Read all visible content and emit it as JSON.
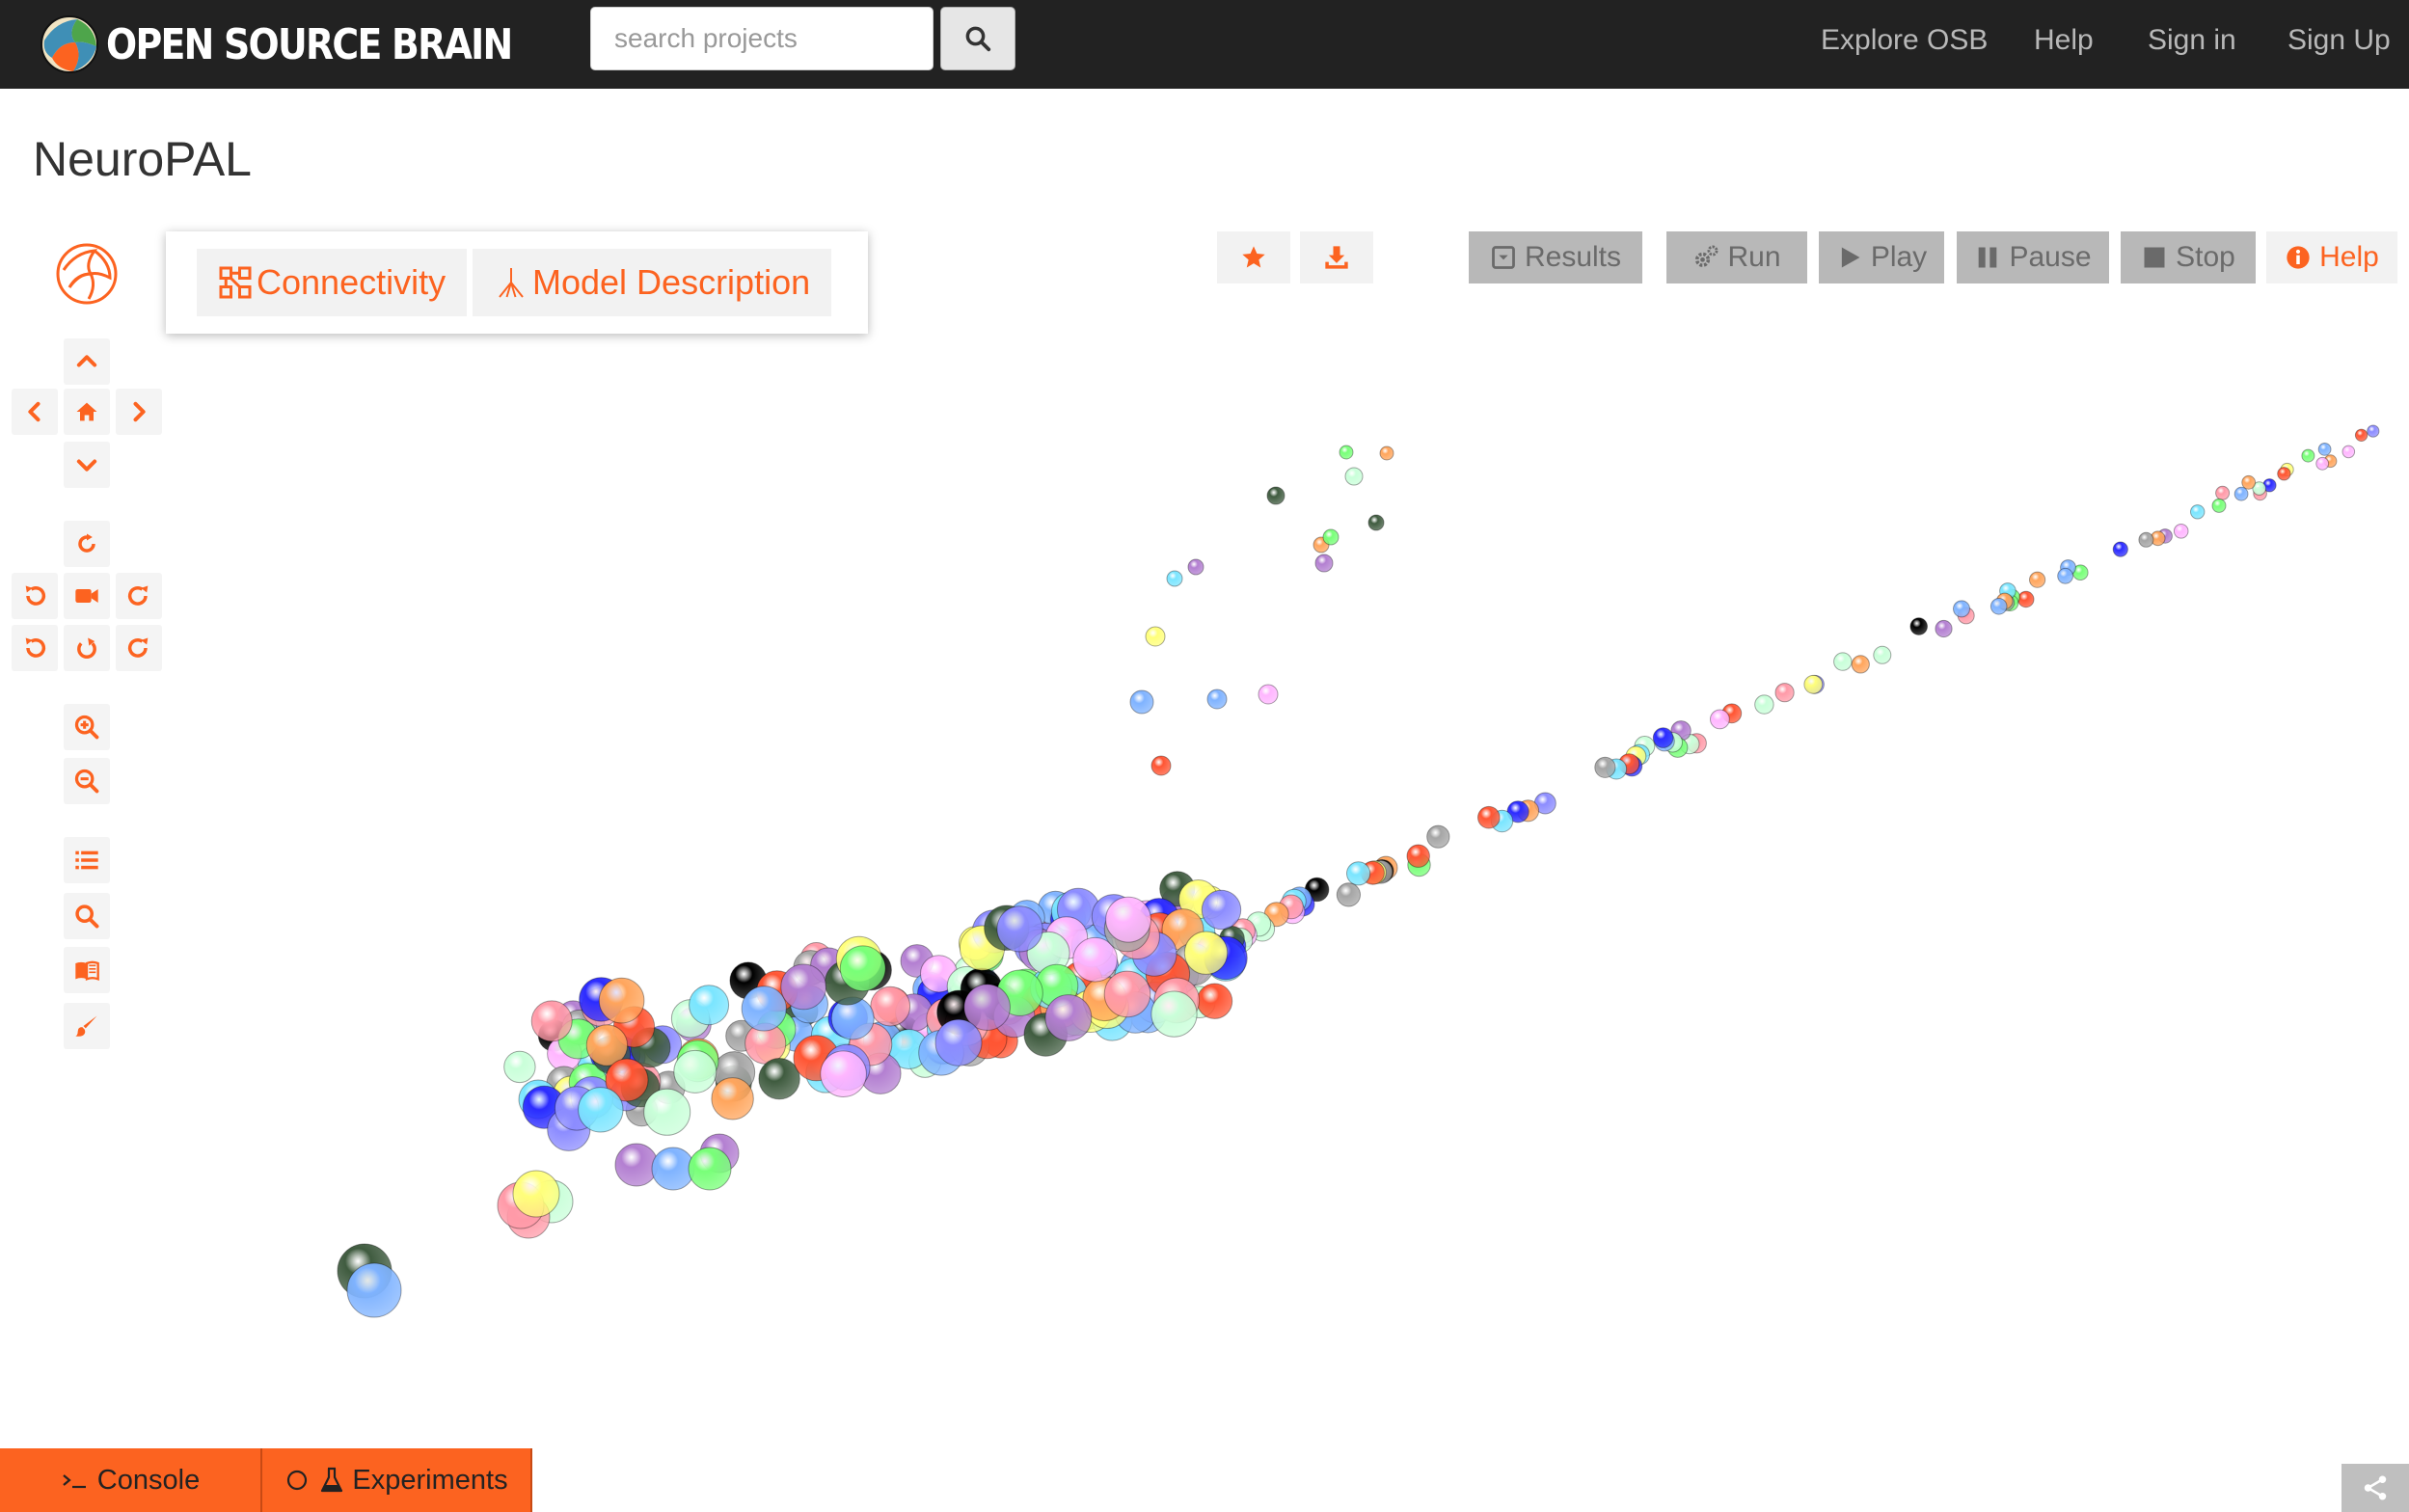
{
  "navbar": {
    "brand": "OPEN SOURCE BRAIN",
    "search_placeholder": "search projects",
    "links": [
      "Explore OSB",
      "Help",
      "Sign in",
      "Sign Up"
    ]
  },
  "project": {
    "title": "NeuroPAL"
  },
  "tabs": {
    "connectivity": "Connectivity",
    "model_description": "Model Description"
  },
  "actions": {
    "results": "Results",
    "run": "Run",
    "play": "Play",
    "pause": "Pause",
    "stop": "Stop",
    "help": "Help"
  },
  "bottom_tabs": {
    "console": "Console",
    "experiments": "Experiments"
  },
  "icons": {
    "navbar": [
      "osb-logo-icon",
      "search-icon"
    ],
    "toolbar": [
      "pan-up-icon",
      "pan-left-icon",
      "home-icon",
      "pan-right-icon",
      "pan-down-icon",
      "rotate-reset-icon",
      "rotate-left-icon",
      "camera-icon",
      "rotate-right-icon",
      "undo-icon",
      "refresh-icon",
      "redo-icon",
      "zoom-in-icon",
      "zoom-out-icon",
      "list-icon",
      "search-icon",
      "book-icon",
      "paint-brush-icon"
    ],
    "actions": [
      "star-icon",
      "download-icon",
      "results-icon",
      "gears-icon",
      "play-icon",
      "pause-icon",
      "stop-icon",
      "info-icon"
    ],
    "bottom": [
      "terminal-icon",
      "circle-icon",
      "flask-icon",
      "share-icon"
    ]
  },
  "colors": {
    "accent": "#fc6320",
    "navbar_bg": "#222222",
    "neurons": [
      "#2b2bff",
      "#78ff78",
      "#ffff7a",
      "#ff5533",
      "#000000",
      "#ffb6ff",
      "#7ae5ff",
      "#3f5b3f",
      "#8c8cff",
      "#ffa55c",
      "#c9ffd9",
      "#b37fd1",
      "#7fb3ff",
      "#ff9aa8",
      "#a5a5a5"
    ]
  }
}
